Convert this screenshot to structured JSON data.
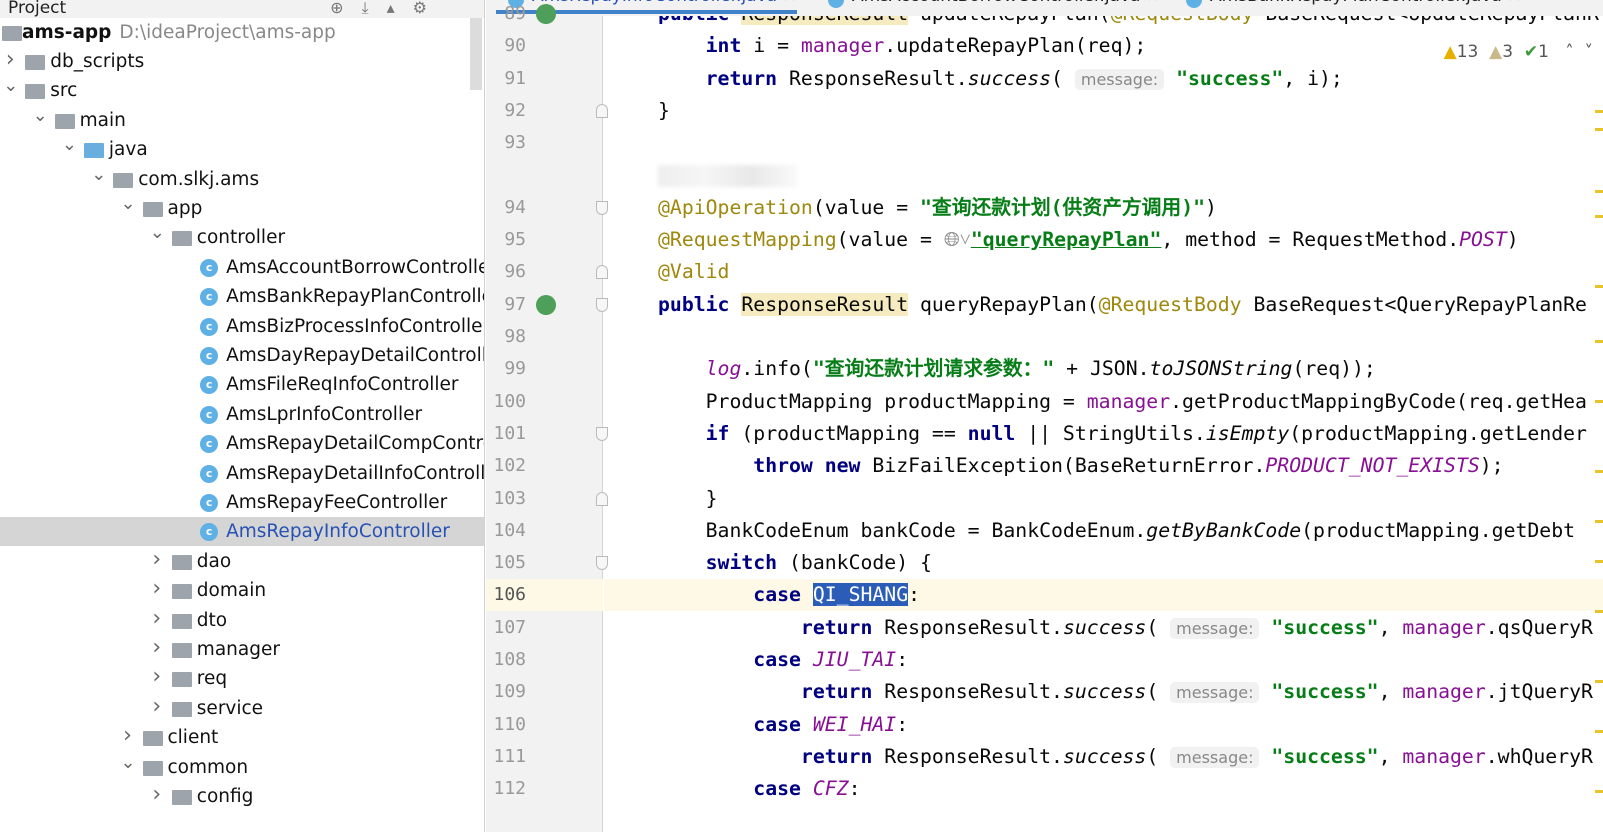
{
  "tree": {
    "header": "Project",
    "root": {
      "name": "ams-app",
      "path": "D:\\ideaProject\\ams-app"
    },
    "items": [
      {
        "label": "db_scripts",
        "level": 1,
        "kind": "folder",
        "expanded": false
      },
      {
        "label": "src",
        "level": 1,
        "kind": "folder",
        "expanded": true
      },
      {
        "label": "main",
        "level": 2,
        "kind": "folder",
        "expanded": true
      },
      {
        "label": "java",
        "level": 3,
        "kind": "source-folder",
        "expanded": true
      },
      {
        "label": "com.slkj.ams",
        "level": 4,
        "kind": "package",
        "expanded": true
      },
      {
        "label": "app",
        "level": 5,
        "kind": "package",
        "expanded": true
      },
      {
        "label": "controller",
        "level": 6,
        "kind": "package",
        "expanded": true
      },
      {
        "label": "AmsAccountBorrowController",
        "level": 7,
        "kind": "class"
      },
      {
        "label": "AmsBankRepayPlanController",
        "level": 7,
        "kind": "class"
      },
      {
        "label": "AmsBizProcessInfoController",
        "level": 7,
        "kind": "class"
      },
      {
        "label": "AmsDayRepayDetailController",
        "level": 7,
        "kind": "class"
      },
      {
        "label": "AmsFileReqInfoController",
        "level": 7,
        "kind": "class"
      },
      {
        "label": "AmsLprInfoController",
        "level": 7,
        "kind": "class"
      },
      {
        "label": "AmsRepayDetailCompControll",
        "level": 7,
        "kind": "class"
      },
      {
        "label": "AmsRepayDetailInfoController",
        "level": 7,
        "kind": "class"
      },
      {
        "label": "AmsRepayFeeController",
        "level": 7,
        "kind": "class"
      },
      {
        "label": "AmsRepayInfoController",
        "level": 7,
        "kind": "class",
        "selected": true
      },
      {
        "label": "dao",
        "level": 6,
        "kind": "package",
        "expanded": false
      },
      {
        "label": "domain",
        "level": 6,
        "kind": "package",
        "expanded": false
      },
      {
        "label": "dto",
        "level": 6,
        "kind": "package",
        "expanded": false
      },
      {
        "label": "manager",
        "level": 6,
        "kind": "package",
        "expanded": false
      },
      {
        "label": "req",
        "level": 6,
        "kind": "package",
        "expanded": false
      },
      {
        "label": "service",
        "level": 6,
        "kind": "package",
        "expanded": false
      },
      {
        "label": "client",
        "level": 5,
        "kind": "package",
        "expanded": false
      },
      {
        "label": "common",
        "level": 5,
        "kind": "package",
        "expanded": true
      },
      {
        "label": "config",
        "level": 6,
        "kind": "package",
        "expanded": false
      }
    ]
  },
  "tabs": [
    {
      "label": "AmsRepayInfoController.java",
      "active": true
    },
    {
      "label": "AmsAccountBorrowController.java"
    },
    {
      "label": "AmsBankRepayPlanController.java"
    }
  ],
  "inspections": {
    "warnings": "13",
    "weak_warnings": "3",
    "typos": "1"
  },
  "editor": {
    "current_line": "106",
    "lines": [
      {
        "n": "89",
        "t": [
          [
            "kw",
            "public "
          ],
          [
            "hl",
            "ResponseResult"
          ],
          [
            "p",
            " updateRepayPlan("
          ],
          [
            "ann",
            "@RequestBody"
          ],
          [
            "p",
            " BaseRequest<UpdateRepayPlanR"
          ]
        ]
      },
      {
        "n": "90",
        "t": [
          [
            "p",
            "    "
          ],
          [
            "kw",
            "int"
          ],
          [
            "p",
            " i = "
          ],
          [
            "fld",
            "manager"
          ],
          [
            "p",
            ".updateRepayPlan(req);"
          ]
        ]
      },
      {
        "n": "91",
        "t": [
          [
            "p",
            "    "
          ],
          [
            "kw",
            "return"
          ],
          [
            "p",
            " ResponseResult."
          ],
          [
            "ital",
            "success"
          ],
          [
            "p",
            "( "
          ],
          [
            "hint",
            "message:"
          ],
          [
            "p",
            " "
          ],
          [
            "str",
            "\"success\""
          ],
          [
            "p",
            ", i);"
          ]
        ]
      },
      {
        "n": "92",
        "t": [
          [
            "p",
            "}"
          ]
        ]
      },
      {
        "n": "93",
        "t": []
      },
      {
        "n": "",
        "blur": true,
        "t": []
      },
      {
        "n": "94",
        "t": [
          [
            "ann",
            "@ApiOperation"
          ],
          [
            "p",
            "(value = "
          ],
          [
            "str",
            "\"查询还款计划(供资产方调用)\""
          ],
          [
            "p",
            ")"
          ]
        ]
      },
      {
        "n": "95",
        "t": [
          [
            "ann",
            "@RequestMapping"
          ],
          [
            "p",
            "(value = "
          ],
          [
            "globe",
            "🌐︎˅"
          ],
          [
            "link",
            "\"queryRepayPlan\""
          ],
          [
            "p",
            ", method = RequestMethod."
          ],
          [
            "sfld",
            "POST"
          ],
          [
            "p",
            ")"
          ]
        ]
      },
      {
        "n": "96",
        "t": [
          [
            "ann",
            "@Valid"
          ]
        ]
      },
      {
        "n": "97",
        "t": [
          [
            "kw",
            "public "
          ],
          [
            "hl",
            "ResponseResult"
          ],
          [
            "p",
            " queryRepayPlan("
          ],
          [
            "ann",
            "@RequestBody"
          ],
          [
            "p",
            " BaseRequest<QueryRepayPlanRe"
          ]
        ]
      },
      {
        "n": "98",
        "t": []
      },
      {
        "n": "99",
        "t": [
          [
            "p",
            "    "
          ],
          [
            "sfld",
            "log"
          ],
          [
            "p",
            ".info("
          ],
          [
            "str",
            "\"查询还款计划请求参数：\""
          ],
          [
            "p",
            " + JSON."
          ],
          [
            "ital",
            "toJSONString"
          ],
          [
            "p",
            "(req));"
          ]
        ]
      },
      {
        "n": "100",
        "t": [
          [
            "p",
            "    ProductMapping productMapping = "
          ],
          [
            "fld",
            "manager"
          ],
          [
            "p",
            ".getProductMappingByCode(req.getHea"
          ]
        ]
      },
      {
        "n": "101",
        "t": [
          [
            "p",
            "    "
          ],
          [
            "kw",
            "if"
          ],
          [
            "p",
            " (productMapping == "
          ],
          [
            "kw",
            "null"
          ],
          [
            "p",
            " || StringUtils."
          ],
          [
            "ital",
            "isEmpty"
          ],
          [
            "p",
            "(productMapping.getLender"
          ]
        ]
      },
      {
        "n": "102",
        "t": [
          [
            "p",
            "        "
          ],
          [
            "kw",
            "throw new"
          ],
          [
            "p",
            " BizFailException(BaseReturnError."
          ],
          [
            "sfld",
            "PRODUCT_NOT_EXISTS"
          ],
          [
            "p",
            ");"
          ]
        ]
      },
      {
        "n": "103",
        "t": [
          [
            "p",
            "    }"
          ]
        ]
      },
      {
        "n": "104",
        "t": [
          [
            "p",
            "    BankCodeEnum bankCode = BankCodeEnum."
          ],
          [
            "ital",
            "getByBankCode"
          ],
          [
            "p",
            "(productMapping.getDebt"
          ]
        ]
      },
      {
        "n": "105",
        "t": [
          [
            "p",
            "    "
          ],
          [
            "kw",
            "switch"
          ],
          [
            "p",
            " (bankCode) {"
          ]
        ]
      },
      {
        "n": "106",
        "t": [
          [
            "p",
            "        "
          ],
          [
            "kw",
            "case"
          ],
          [
            "p",
            " "
          ],
          [
            "sel",
            "QI_SHANG"
          ],
          [
            "p",
            ":"
          ]
        ]
      },
      {
        "n": "107",
        "t": [
          [
            "p",
            "            "
          ],
          [
            "kw",
            "return"
          ],
          [
            "p",
            " ResponseResult."
          ],
          [
            "ital",
            "success"
          ],
          [
            "p",
            "( "
          ],
          [
            "hint",
            "message:"
          ],
          [
            "p",
            " "
          ],
          [
            "str",
            "\"success\""
          ],
          [
            "p",
            ", "
          ],
          [
            "fld",
            "manager"
          ],
          [
            "p",
            ".qsQueryR"
          ]
        ]
      },
      {
        "n": "108",
        "t": [
          [
            "p",
            "        "
          ],
          [
            "kw",
            "case"
          ],
          [
            "p",
            " "
          ],
          [
            "sfld",
            "JIU_TAI"
          ],
          [
            "p",
            ":"
          ]
        ]
      },
      {
        "n": "109",
        "t": [
          [
            "p",
            "            "
          ],
          [
            "kw",
            "return"
          ],
          [
            "p",
            " ResponseResult."
          ],
          [
            "ital",
            "success"
          ],
          [
            "p",
            "( "
          ],
          [
            "hint",
            "message:"
          ],
          [
            "p",
            " "
          ],
          [
            "str",
            "\"success\""
          ],
          [
            "p",
            ", "
          ],
          [
            "fld",
            "manager"
          ],
          [
            "p",
            ".jtQueryR"
          ]
        ]
      },
      {
        "n": "110",
        "t": [
          [
            "p",
            "        "
          ],
          [
            "kw",
            "case"
          ],
          [
            "p",
            " "
          ],
          [
            "sfld",
            "WEI_HAI"
          ],
          [
            "p",
            ":"
          ]
        ]
      },
      {
        "n": "111",
        "t": [
          [
            "p",
            "            "
          ],
          [
            "kw",
            "return"
          ],
          [
            "p",
            " ResponseResult."
          ],
          [
            "ital",
            "success"
          ],
          [
            "p",
            "( "
          ],
          [
            "hint",
            "message:"
          ],
          [
            "p",
            " "
          ],
          [
            "str",
            "\"success\""
          ],
          [
            "p",
            ", "
          ],
          [
            "fld",
            "manager"
          ],
          [
            "p",
            ".whQueryR"
          ]
        ]
      },
      {
        "n": "112",
        "t": [
          [
            "p",
            "        "
          ],
          [
            "kw",
            "case"
          ],
          [
            "p",
            " "
          ],
          [
            "sfld",
            "CFZ"
          ],
          [
            "p",
            ":"
          ]
        ]
      }
    ]
  }
}
